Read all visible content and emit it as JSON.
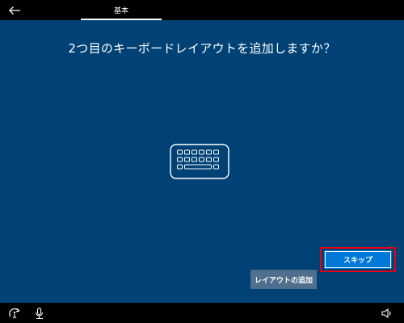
{
  "topbar": {
    "tab_label": "基本",
    "back_icon": "back-arrow-icon"
  },
  "main": {
    "title": "2つ目のキーボードレイアウトを追加しますか？",
    "illustration_icon": "keyboard-icon",
    "add_layout_label": "レイアウトの追加",
    "skip_label": "スキップ"
  },
  "bottombar": {
    "left_icons": [
      "ease-of-access-icon",
      "microphone-icon"
    ],
    "right_icons": [
      "volume-icon"
    ]
  },
  "colors": {
    "main_bg": "#004275",
    "bar_bg": "#000000",
    "primary_button": "#0078d7",
    "secondary_button": "#4f6f8e",
    "highlight": "#e60012"
  }
}
